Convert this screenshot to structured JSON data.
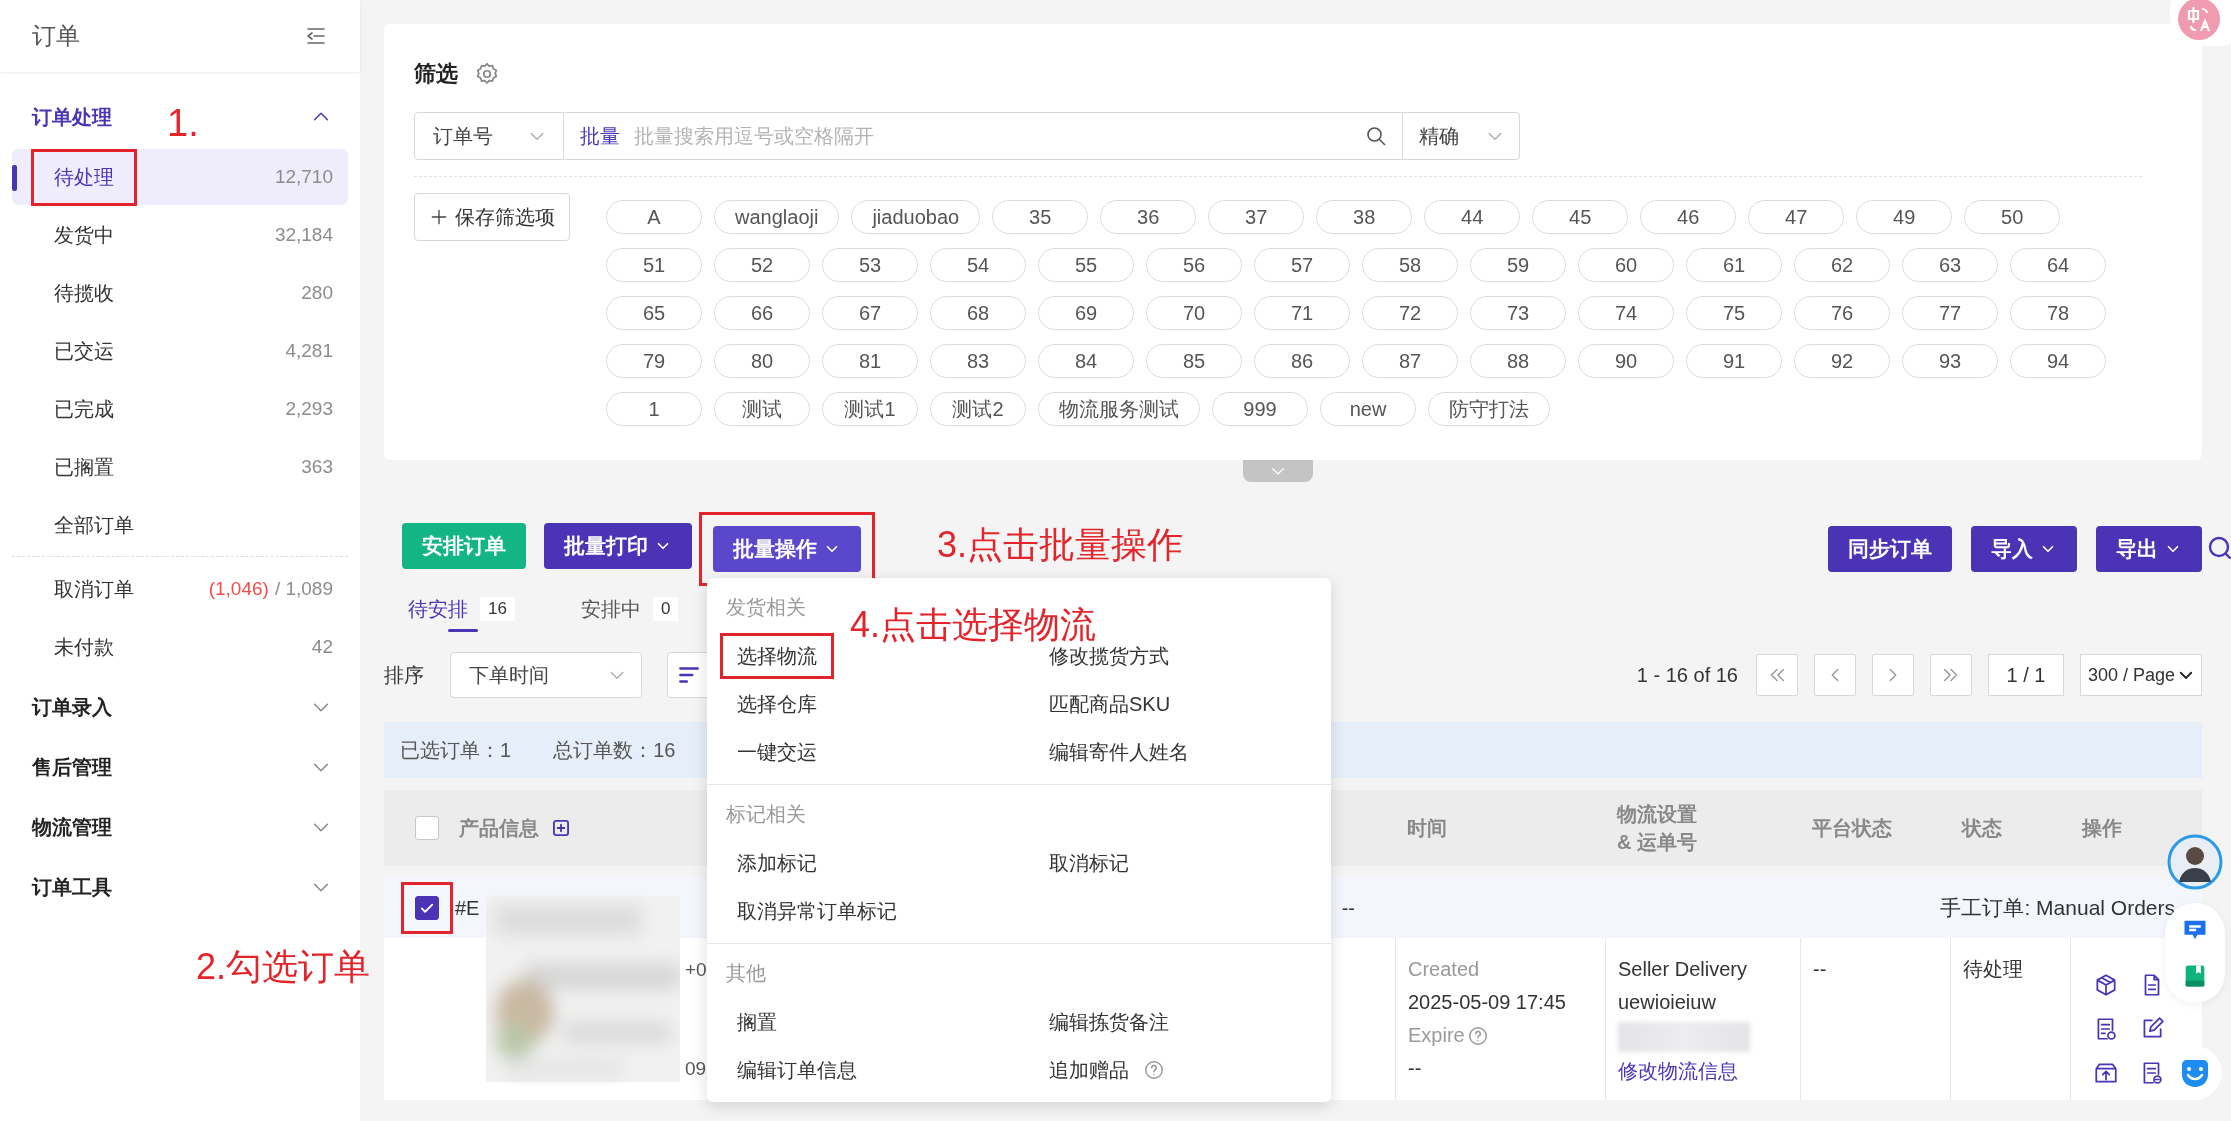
{
  "sidebar": {
    "title": "订单",
    "groups": [
      {
        "label": "订单处理",
        "expanded": true,
        "items": [
          {
            "label": "待处理",
            "count": "12,710",
            "selected": true,
            "annotated": true
          },
          {
            "label": "发货中",
            "count": "32,184",
            "selected": false,
            "annotated": false
          },
          {
            "label": "待揽收",
            "count": "280",
            "selected": false,
            "annotated": false
          },
          {
            "label": "已交运",
            "count": "4,281",
            "selected": false,
            "annotated": false
          },
          {
            "label": "已完成",
            "count": "2,293",
            "selected": false,
            "annotated": false
          },
          {
            "label": "已搁置",
            "count": "363",
            "selected": false,
            "annotated": false
          },
          {
            "label": "全部订单",
            "selected": false,
            "annotated": false
          }
        ],
        "other_items": [
          {
            "label": "取消订单",
            "alert_count": "(1,046)",
            "count": "/ 1,089",
            "selected": false,
            "annotated": false
          },
          {
            "label": "未付款",
            "count": "42",
            "selected": false,
            "annotated": false
          }
        ]
      },
      {
        "label": "订单录入",
        "expanded": false
      },
      {
        "label": "售后管理",
        "expanded": false
      },
      {
        "label": "物流管理",
        "expanded": false
      },
      {
        "label": "订单工具",
        "expanded": false
      }
    ]
  },
  "filter": {
    "title": "筛选",
    "search": {
      "field": "订单号",
      "mode_label": "批量",
      "placeholder": "批量搜索用逗号或空格隔开",
      "match": "精确"
    },
    "save_button": "保存筛选项",
    "chips": [
      "A",
      "wanglaoji",
      "jiaduobao",
      "35",
      "36",
      "37",
      "38",
      "44",
      "45",
      "46",
      "47",
      "49",
      "50",
      "51",
      "52",
      "53",
      "54",
      "55",
      "56",
      "57",
      "58",
      "59",
      "60",
      "61",
      "62",
      "63",
      "64",
      "65",
      "66",
      "67",
      "68",
      "69",
      "70",
      "71",
      "72",
      "73",
      "74",
      "75",
      "76",
      "77",
      "78",
      "79",
      "80",
      "81",
      "83",
      "84",
      "85",
      "86",
      "87",
      "88",
      "90",
      "91",
      "92",
      "93",
      "94",
      "1",
      "测试",
      "测试1",
      "测试2",
      "物流服务测试",
      "999",
      "new",
      "防守打法"
    ]
  },
  "toolbar": {
    "left": [
      {
        "label": "安排订单",
        "kind": "success",
        "dropdown": false,
        "annotated": false
      },
      {
        "label": "批量打印",
        "kind": "primary",
        "dropdown": true,
        "annotated": false
      },
      {
        "label": "批量操作",
        "kind": "active",
        "dropdown": true,
        "annotated": true
      }
    ],
    "right": [
      {
        "label": "同步订单",
        "kind": "primary",
        "dropdown": false,
        "annotated": false
      },
      {
        "label": "导入",
        "kind": "primary",
        "dropdown": true,
        "annotated": false
      },
      {
        "label": "导出",
        "kind": "primary",
        "dropdown": true,
        "annotated": false
      }
    ]
  },
  "tabs": [
    {
      "label": "待安排",
      "count": "16",
      "selected": true
    },
    {
      "label": "安排中",
      "count": "0",
      "selected": false
    }
  ],
  "sort": {
    "label": "排序",
    "value": "下单时间"
  },
  "pagination": {
    "range": "1 - 16 of 16",
    "page": "1 / 1",
    "page_size": "300 / Page"
  },
  "selection": {
    "selected": "已选订单：1",
    "total": "总订单数：16"
  },
  "table": {
    "header_checked": false,
    "columns": [
      {
        "lines": [
          "产品信息"
        ]
      },
      {
        "lines": [
          "时间"
        ]
      },
      {
        "lines": [
          "物流设置",
          "& 运单号"
        ]
      },
      {
        "lines": [
          "平台状态"
        ]
      },
      {
        "lines": [
          "状态"
        ]
      },
      {
        "lines": [
          "操作"
        ]
      }
    ],
    "orders": [
      {
        "checked": true,
        "annotated": true,
        "number": "#E",
        "dash": "--",
        "source": "手工订单: Manual Orders",
        "product_texts": [
          "+0",
          "09"
        ],
        "created_label": "Created",
        "created": "2025-05-09 17:45",
        "expire_label": "Expire",
        "expire": "--",
        "logistics_method": "Seller Delivery",
        "tracking": "uewioieiuw",
        "logistics_link": "修改物流信息",
        "platform_status": "--",
        "status": "待处理"
      }
    ]
  },
  "menu": {
    "sections": [
      {
        "title": "发货相关",
        "items": [
          {
            "label": "选择物流",
            "annotated": true,
            "help": false
          },
          {
            "label": "修改揽货方式",
            "annotated": false,
            "help": false
          },
          {
            "label": "选择仓库",
            "annotated": false,
            "help": false
          },
          {
            "label": "匹配商品SKU",
            "annotated": false,
            "help": false
          },
          {
            "label": "一键交运",
            "annotated": false,
            "help": false
          },
          {
            "label": "编辑寄件人姓名",
            "annotated": false,
            "help": false
          }
        ]
      },
      {
        "title": "标记相关",
        "items": [
          {
            "label": "添加标记",
            "annotated": false,
            "help": false
          },
          {
            "label": "取消标记",
            "annotated": false,
            "help": false
          },
          {
            "label": "取消异常订单标记",
            "annotated": false,
            "help": false
          }
        ]
      },
      {
        "title": "其他",
        "items": [
          {
            "label": "搁置",
            "annotated": false,
            "help": false
          },
          {
            "label": "编辑拣货备注",
            "annotated": false,
            "help": false
          },
          {
            "label": "编辑订单信息",
            "annotated": false,
            "help": false
          },
          {
            "label": "追加赠品",
            "annotated": false,
            "help": true
          }
        ]
      }
    ]
  },
  "annotations": [
    {
      "text": "1."
    },
    {
      "text": "2.勾选订单"
    },
    {
      "text": "3.点击批量操作"
    },
    {
      "text": "4.点击选择物流"
    }
  ]
}
